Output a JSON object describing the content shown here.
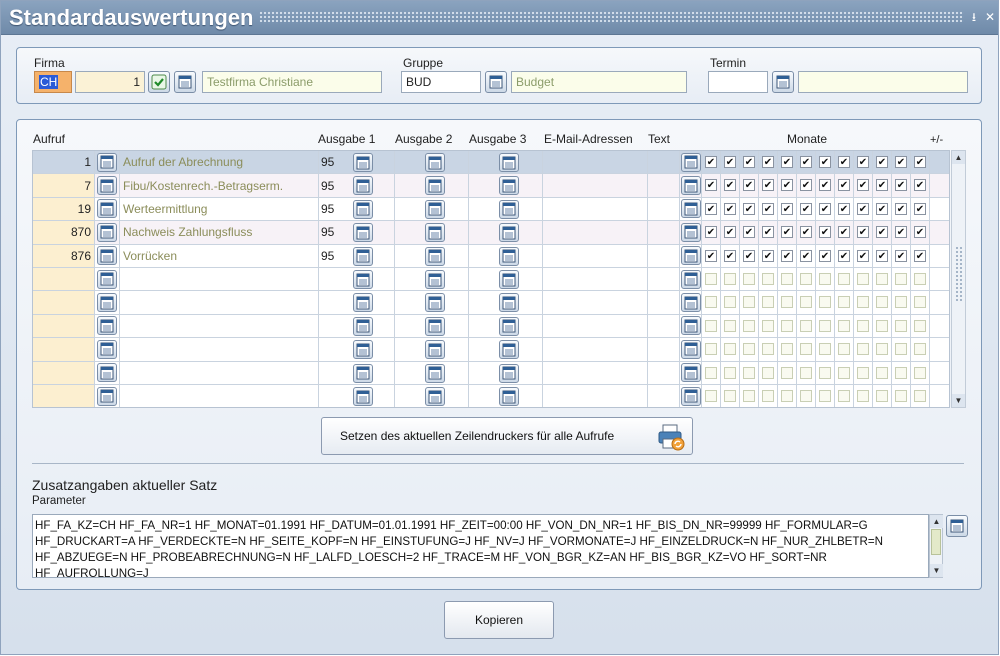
{
  "window": {
    "title": "Standardauswertungen"
  },
  "header": {
    "firma_label": "Firma",
    "firma_code": "CH",
    "firma_nr": "1",
    "firma_name": "Testfirma Christiane",
    "gruppe_label": "Gruppe",
    "gruppe_code": "BUD",
    "gruppe_name": "Budget",
    "termin_label": "Termin",
    "termin_value": "",
    "termin_extra": ""
  },
  "grid": {
    "columns": {
      "aufruf": "Aufruf",
      "ausgabe1": "Ausgabe 1",
      "ausgabe2": "Ausgabe 2",
      "ausgabe3": "Ausgabe 3",
      "email": "E-Mail-Adressen",
      "text": "Text",
      "monate": "Monate",
      "plusminus": "+/-"
    },
    "rows": [
      {
        "nr": "1",
        "name": "Aufruf der Abrechnung",
        "ausgabe1": "95",
        "months": true
      },
      {
        "nr": "7",
        "name": "Fibu/Kostenrech.-Betragserm.",
        "ausgabe1": "95",
        "months": true
      },
      {
        "nr": "19",
        "name": "Werteermittlung",
        "ausgabe1": "95",
        "months": true
      },
      {
        "nr": "870",
        "name": "Nachweis Zahlungsfluss",
        "ausgabe1": "95",
        "months": true
      },
      {
        "nr": "876",
        "name": "Vorrücken",
        "ausgabe1": "95",
        "months": true
      },
      {
        "nr": "",
        "name": "",
        "ausgabe1": "",
        "months": false
      },
      {
        "nr": "",
        "name": "",
        "ausgabe1": "",
        "months": false
      },
      {
        "nr": "",
        "name": "",
        "ausgabe1": "",
        "months": false
      },
      {
        "nr": "",
        "name": "",
        "ausgabe1": "",
        "months": false
      },
      {
        "nr": "",
        "name": "",
        "ausgabe1": "",
        "months": false
      },
      {
        "nr": "",
        "name": "",
        "ausgabe1": "",
        "months": false
      }
    ]
  },
  "buttons": {
    "zeilendrucker": "Setzen des aktuellen Zeilendruckers für alle Aufrufe",
    "kopieren": "Kopieren"
  },
  "zusatz": {
    "title": "Zusatzangaben aktueller Satz",
    "param_label": "Parameter",
    "param_text": "HF_FA_KZ=CH HF_FA_NR=1 HF_MONAT=01.1991 HF_DATUM=01.01.1991 HF_ZEIT=00:00 HF_VON_DN_NR=1 HF_BIS_DN_NR=99999 HF_FORMULAR=G HF_DRUCKART=A HF_VERDECKTE=N HF_SEITE_KOPF=N HF_EINSTUFUNG=J HF_NV=J HF_VORMONATE=J HF_EINZELDRUCK=N HF_NUR_ZHLBETR=N HF_ABZUEGE=N HF_PROBEABRECHNUNG=N HF_LALFD_LOESCH=2 HF_TRACE=M HF_VON_BGR_KZ=AN HF_BIS_BGR_KZ=VO HF_SORT=NR HF_AUFROLLUNG=J"
  },
  "icons": {
    "calendar": "calendar-list-icon",
    "check": "check-icon",
    "printer": "printer-icon"
  }
}
